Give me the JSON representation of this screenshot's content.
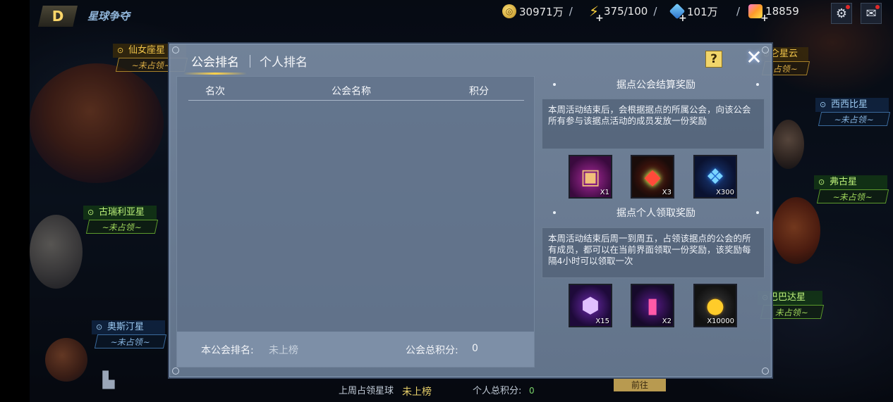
{
  "top_bar": {
    "title": "星球争夺",
    "resources": [
      {
        "icon": "gold-coin-icon",
        "value": "30971万"
      },
      {
        "icon": "energy-bolt-icon",
        "value": "375/100"
      },
      {
        "icon": "blue-gem-icon",
        "value": "101万"
      },
      {
        "icon": "crystal-icon",
        "value": "18859"
      }
    ]
  },
  "map": {
    "star_labels": [
      {
        "name": "仙女座星",
        "status": "~未占领~",
        "color": "gold"
      },
      {
        "name": "古瑞利亚星",
        "status": "~未占领~",
        "color": "green"
      },
      {
        "name": "奥斯汀星",
        "status": "~未占领~",
        "color": "blue"
      },
      {
        "name": "西西比星",
        "status": "~未占领~",
        "color": "blue"
      },
      {
        "name": "弗古星",
        "status": "~未占领~",
        "color": "green"
      },
      {
        "name": "仑星云",
        "status": "占领~",
        "color": "gold"
      },
      {
        "name": "巴巴达星",
        "status": "未占领~",
        "color": "green"
      }
    ],
    "footer": {
      "last_week_label": "上周占领星球",
      "last_week_value": "未上榜",
      "personal_total_label": "个人总积分:",
      "personal_total_value": "0",
      "go_button": "前往"
    }
  },
  "dialog": {
    "tabs": [
      {
        "label": "公会排名",
        "active": true
      },
      {
        "label": "个人排名",
        "active": false
      }
    ],
    "help_label": "?",
    "close_label": "✕",
    "ranking": {
      "columns": [
        "名次",
        "公会名称",
        "积分"
      ],
      "rows": [],
      "my_rank_label": "本公会排名:",
      "my_rank_value": "未上榜",
      "total_score_label": "公会总积分:",
      "total_score_value": "0"
    },
    "guild_reward": {
      "title": "据点公会结算奖励",
      "description": "本周活动结束后，会根据据点的所属公会，向该公会所有参与该据点活动的成员发放一份奖励",
      "items": [
        {
          "icon": "treasure-chest-icon",
          "count": "X1"
        },
        {
          "icon": "ruby-gem-icon",
          "count": "X3"
        },
        {
          "icon": "blue-crystal-icon",
          "count": "X300"
        }
      ]
    },
    "personal_reward": {
      "title": "据点个人领取奖励",
      "description": "本周活动结束后周一到周五，占领该据点的公会的所有成员，都可以在当前界面领取一份奖励，该奖励每隔4小时可以领取一次",
      "items": [
        {
          "icon": "purple-cube-icon",
          "count": "X15"
        },
        {
          "icon": "energy-vial-icon",
          "count": "X2"
        },
        {
          "icon": "gold-coins-icon",
          "count": "X10000"
        }
      ]
    }
  }
}
